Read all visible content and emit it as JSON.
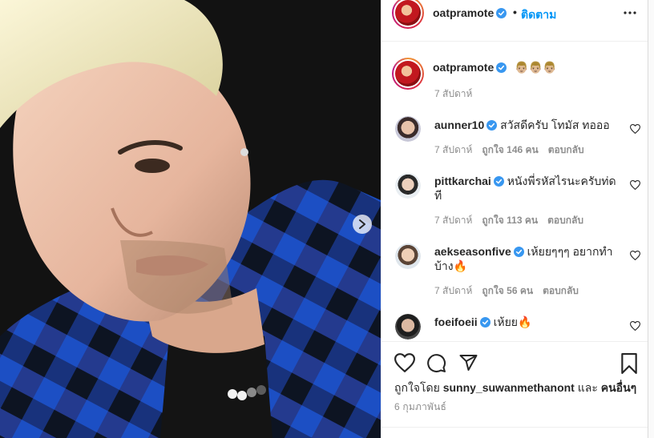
{
  "post": {
    "author": "oatpramote",
    "follow_label": "ติดตาม",
    "caption": "👨🏼👨🏼👨🏼",
    "caption_time": "7 สัปดาห์",
    "likes_prefix": "ถูกใจโดย",
    "likes_user": "sunny_suwanmethanont",
    "likes_and": "และ",
    "likes_others": "คนอื่นๆ",
    "date": "6 กุมภาพันธ์"
  },
  "comments": [
    {
      "user": "aunner10",
      "text": "สวัสดีครับ โทมัส ทอออ",
      "text2": "",
      "time": "7 สัปดาห์",
      "likes": "ถูกใจ 146 คน",
      "reply": "ตอบกลับ"
    },
    {
      "user": "pittkarchai",
      "text": "หนังพี่รหัสไรนะครับท่ด",
      "text2": "ที",
      "time": "7 สัปดาห์",
      "likes": "ถูกใจ 113 คน",
      "reply": "ตอบกลับ"
    },
    {
      "user": "aekseasonfive",
      "text": "เห้ยยๆๆๆ อยากทำ",
      "text2": "บ้าง🔥",
      "time": "7 สัปดาห์",
      "likes": "ถูกใจ 56 คน",
      "reply": "ตอบกลับ"
    },
    {
      "user": "foeifoeii",
      "text": "เห้ยย🔥",
      "text2": "",
      "time": "",
      "likes": "",
      "reply": ""
    }
  ],
  "colors": {
    "accent": "#0095f6",
    "verified": "#3897f0",
    "muted": "#8e8e8e"
  },
  "icons": [
    "verified-badge-icon",
    "more-icon",
    "heart-icon",
    "comment-icon",
    "share-icon",
    "bookmark-icon",
    "chevron-right-icon"
  ]
}
